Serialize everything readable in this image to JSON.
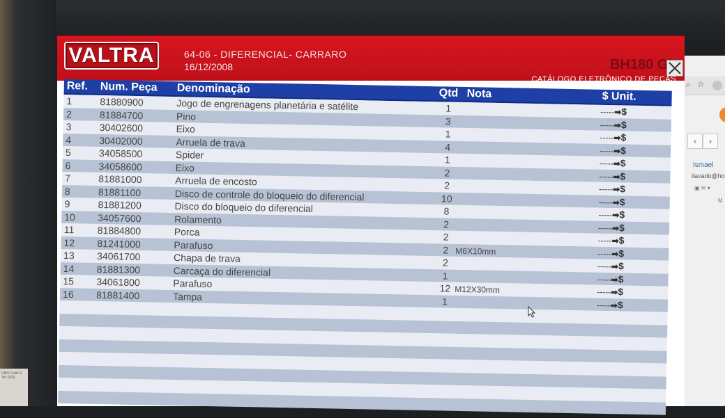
{
  "paper": {
    "text": "UNIV Calle S Tel: (511)"
  },
  "app": {
    "logo": "VALTRA",
    "title": "64-06 - DIFERENCIAL- CARRARO",
    "date": "16/12/2008",
    "model": "BH180 GI",
    "catalog": "CATÁLOGO ELETRÔNICO DE PEÇAS"
  },
  "table": {
    "headers": {
      "ref": "Ref.",
      "num": "Num. Peça",
      "desc": "Denominação",
      "qtd": "Qtd",
      "nota": "Nota",
      "price": "$ Unit."
    },
    "price_placeholder": "-----",
    "rows": [
      {
        "ref": "1",
        "num": "81880900",
        "desc": "Jogo de engrenagens planetária e satélite",
        "qtd": "1",
        "nota": ""
      },
      {
        "ref": "2",
        "num": "81884700",
        "desc": "Pino",
        "qtd": "3",
        "nota": ""
      },
      {
        "ref": "3",
        "num": "30402600",
        "desc": "Eixo",
        "qtd": "1",
        "nota": ""
      },
      {
        "ref": "4",
        "num": "30402000",
        "desc": "Arruela de trava",
        "qtd": "4",
        "nota": ""
      },
      {
        "ref": "5",
        "num": "34058500",
        "desc": "Spider",
        "qtd": "1",
        "nota": ""
      },
      {
        "ref": "6",
        "num": "34058600",
        "desc": "Eixo",
        "qtd": "2",
        "nota": ""
      },
      {
        "ref": "7",
        "num": "81881000",
        "desc": "Arruela de encosto",
        "qtd": "2",
        "nota": ""
      },
      {
        "ref": "8",
        "num": "81881100",
        "desc": "Disco de controle do bloqueio do diferencial",
        "qtd": "10",
        "nota": ""
      },
      {
        "ref": "9",
        "num": "81881200",
        "desc": "Disco do bloqueio do diferencial",
        "qtd": "8",
        "nota": ""
      },
      {
        "ref": "10",
        "num": "34057600",
        "desc": "Rolamento",
        "qtd": "2",
        "nota": ""
      },
      {
        "ref": "11",
        "num": "81884800",
        "desc": "Porca",
        "qtd": "2",
        "nota": ""
      },
      {
        "ref": "12",
        "num": "81241000",
        "desc": "Parafuso",
        "qtd": "2",
        "nota": "M6X10mm"
      },
      {
        "ref": "13",
        "num": "34061700",
        "desc": "Chapa de trava",
        "qtd": "2",
        "nota": ""
      },
      {
        "ref": "14",
        "num": "81881300",
        "desc": "Carcaça do diferencial",
        "qtd": "1",
        "nota": ""
      },
      {
        "ref": "15",
        "num": "34061800",
        "desc": "Parafuso",
        "qtd": "12",
        "nota": "M12X30mm"
      },
      {
        "ref": "16",
        "num": "81881400",
        "desc": "Tampa",
        "qtd": "1",
        "nota": ""
      }
    ]
  },
  "browser": {
    "user_name": "Ismael",
    "user_email": "ilavado@ho",
    "m_label": "M"
  },
  "icons": {
    "close": "close-icon",
    "arrow": "arrow-right-icon",
    "search": "search-icon",
    "star": "star-icon",
    "cursor": "mouse-cursor-icon"
  },
  "colors": {
    "header_red": "#d7151f",
    "table_header_blue": "#1e3fa6",
    "row_light": "#e9edf3",
    "row_dark": "#b7c3d4"
  }
}
